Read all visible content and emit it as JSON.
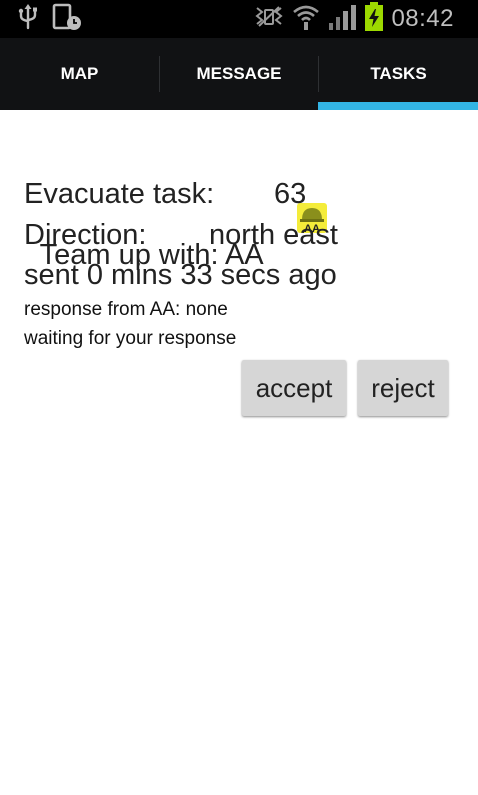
{
  "status_bar": {
    "time": "08:42",
    "icons": [
      "usb-icon",
      "screenshot-icon",
      "mute-icon",
      "wifi-icon",
      "signal-icon",
      "battery-charging-icon"
    ]
  },
  "tabs": [
    {
      "label": "MAP",
      "selected": false
    },
    {
      "label": "MESSAGE",
      "selected": false
    },
    {
      "label": "TASKS",
      "selected": true
    }
  ],
  "accent_color": "#33b5e5",
  "task": {
    "team_label": "Team up with: AA",
    "evacuate_label": "Evacuate task:",
    "evacuate_value": "63",
    "direction_label": "Direction:",
    "direction_value": "north east",
    "sent_text": "sent 0 mins 33 secs ago",
    "response_text": "response from AA: none",
    "waiting_text": "waiting for your response",
    "avatar_icon": "helmet-icon",
    "avatar_label": "AA"
  },
  "actions": {
    "accept_label": "accept",
    "reject_label": "reject"
  }
}
